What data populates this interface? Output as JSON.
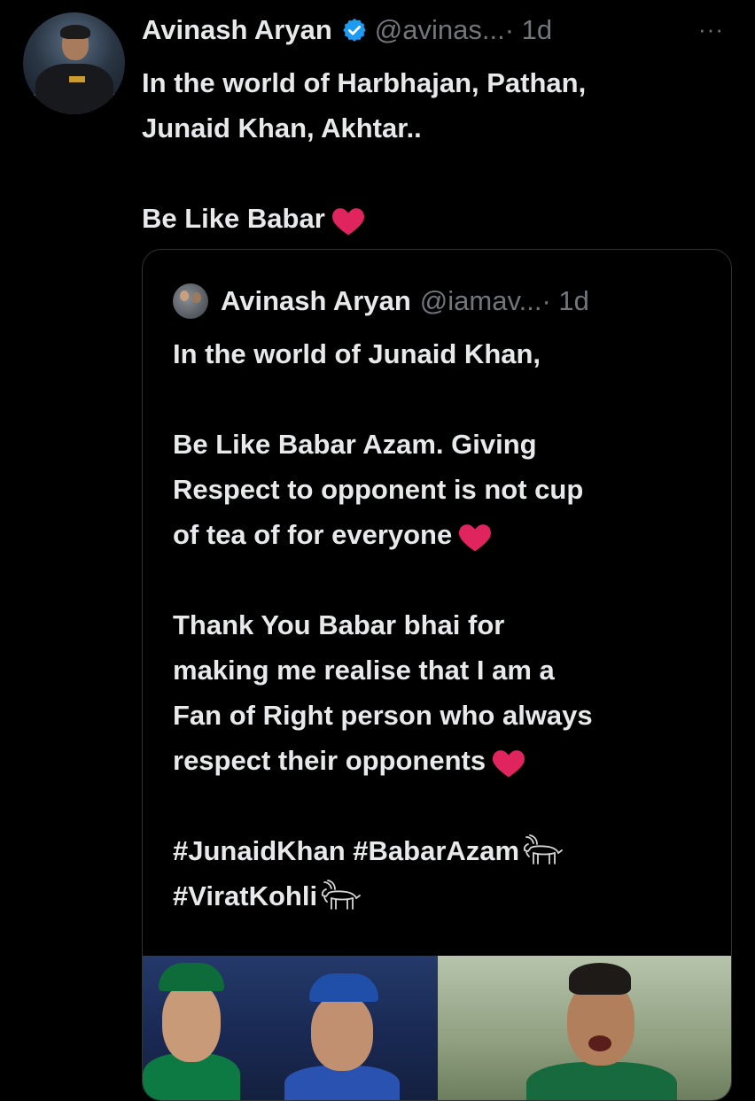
{
  "tweet": {
    "author_name": "Avinash Aryan",
    "handle": "@avinas...",
    "time": "· 1d",
    "more_label": "···",
    "text_lines": [
      "In the world of Harbhajan, Pathan,",
      "Junaid Khan, Akhtar.."
    ],
    "text_line_3": "Be Like Babar"
  },
  "quoted": {
    "author_name": "Avinash Aryan",
    "handle": "@iamav...",
    "time": "· 1d",
    "line_1": "In the world of Junaid Khan,",
    "line_2": "Be Like Babar Azam. Giving",
    "line_3": "Respect to opponent is not cup",
    "line_4": "of tea of for everyone",
    "line_5": "Thank You Babar bhai for",
    "line_6": "making me realise that I am a",
    "line_7": "Fan of Right person who always",
    "line_8": "respect their opponents",
    "hashtag_1": "#JunaidKhan",
    "hashtag_2": "#BabarAzam",
    "hashtag_3": "#ViratKohli"
  },
  "icons": {
    "verified": "verified-badge-icon",
    "heart": "red-heart-emoji",
    "goat": "goat-emoji"
  },
  "colors": {
    "background": "#000000",
    "text": "#e7e9ea",
    "muted": "#71767b",
    "verified": "#1d9bf0",
    "heart": "#e0245e"
  }
}
